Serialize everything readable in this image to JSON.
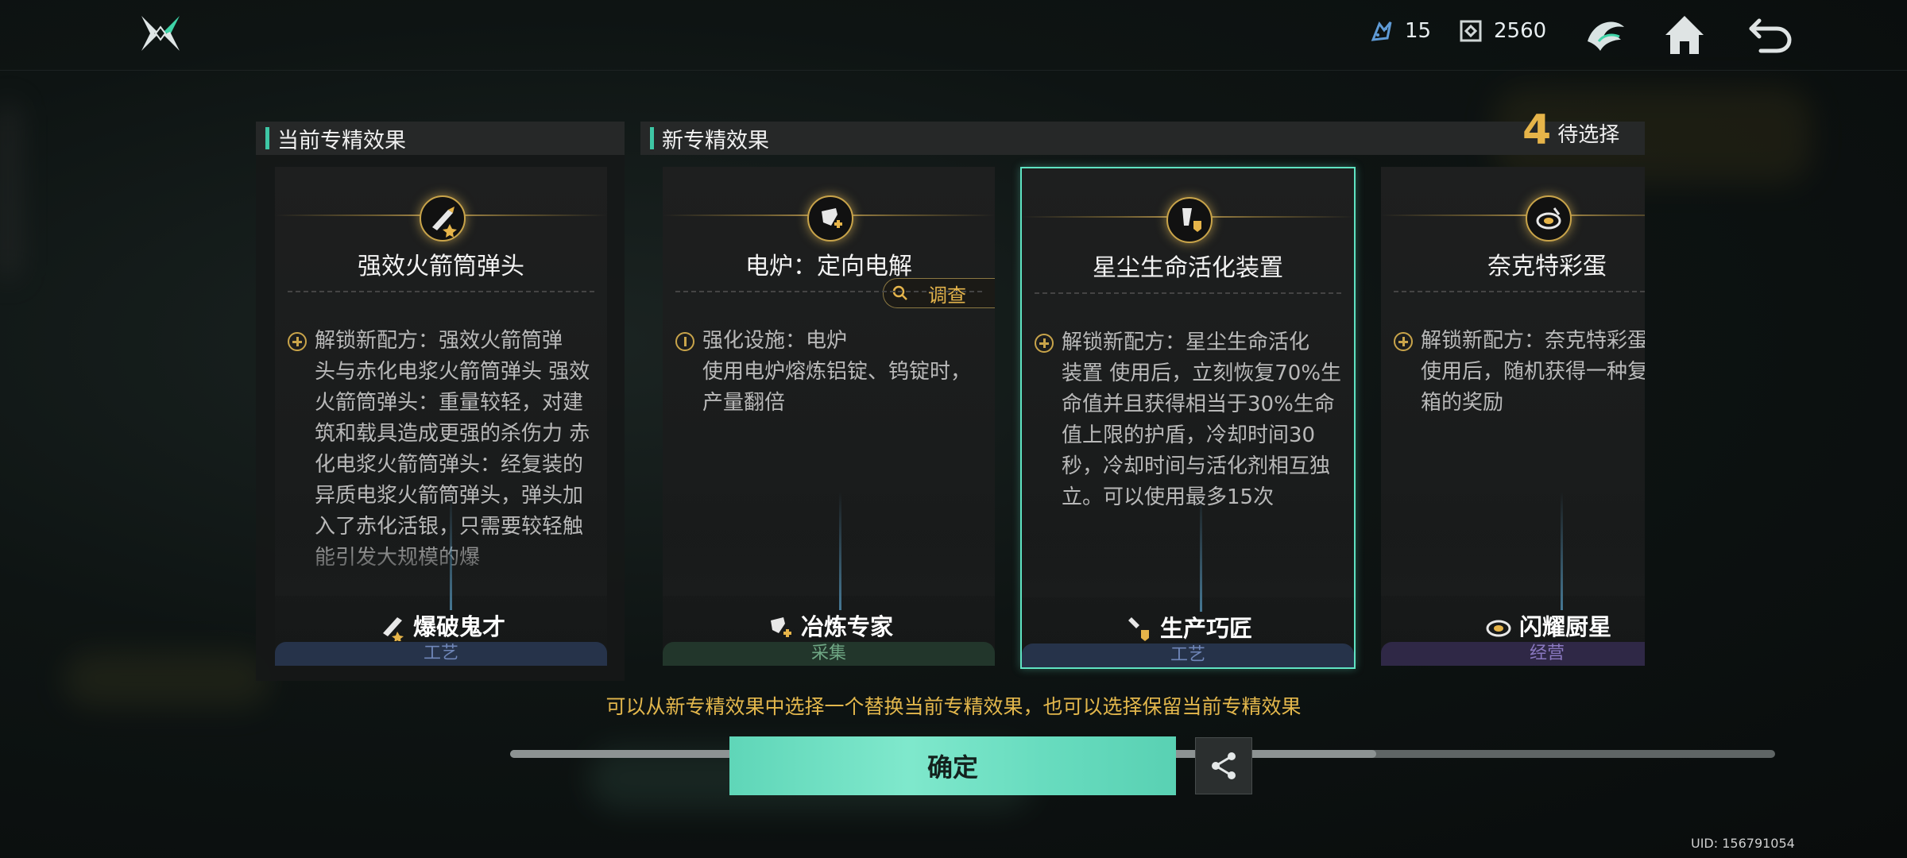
{
  "header": {
    "resource_1_value": "15",
    "resource_2_value": "2560",
    "icons": [
      "logo-icon",
      "crystal-icon",
      "chip-icon",
      "wing-emblem-icon",
      "home-icon",
      "back-icon"
    ]
  },
  "current_panel": {
    "heading": "当前专精效果"
  },
  "new_panel": {
    "heading": "新专精效果",
    "pending_count": "4",
    "pending_label": "待选择"
  },
  "cards": [
    {
      "title": "强效火箭筒弹头",
      "desc_lead": "解锁新配方：强效火箭筒弹",
      "desc_rest": "头与赤化电浆火箭筒弹头 强效火箭筒弹头：重量较轻，对建筑和载具造成更强的杀伤力 赤化电浆火箭筒弹头：经复装的异质电浆火箭筒弹头，弹头加入了赤化活银，只需要较轻触能引发大规模的爆",
      "trait": "爆破鬼才",
      "category": "工艺",
      "selected": false
    },
    {
      "title": "电炉：定向电解",
      "probe_label": "调查",
      "desc_lead": "强化设施：电炉",
      "desc_rest": "使用电炉熔炼铝锭、钨锭时，产量翻倍",
      "trait": "冶炼专家",
      "category": "采集",
      "selected": false
    },
    {
      "title": "星尘生命活化装置",
      "desc_lead": "解锁新配方：星尘生命活化",
      "desc_rest": "装置 使用后，立刻恢复70%生命值并且获得相当于30%生命值上限的护盾，冷却时间30秒，冷却时间与活化剂相互独立。可以使用最多15次",
      "trait": "生产巧匠",
      "category": "工艺",
      "selected": true
    },
    {
      "title": "奈克特彩蛋",
      "desc_lead": "解锁新配方：奈克特彩蛋",
      "desc_rest": "使用后，随机获得一种复苏宝箱的奖励",
      "trait": "闪耀厨星",
      "category": "经营",
      "selected": false
    }
  ],
  "hint": "可以从新专精效果中选择一个替换当前专精效果，也可以选择保留当前专精效果",
  "confirm_label": "确定",
  "uid": "UID: 156791054",
  "colors": {
    "accent": "#5fe3c2",
    "gold": "#e3b74c",
    "craft": "#3a4a66",
    "gather": "#3a5a45",
    "manage": "#4a3e66"
  }
}
